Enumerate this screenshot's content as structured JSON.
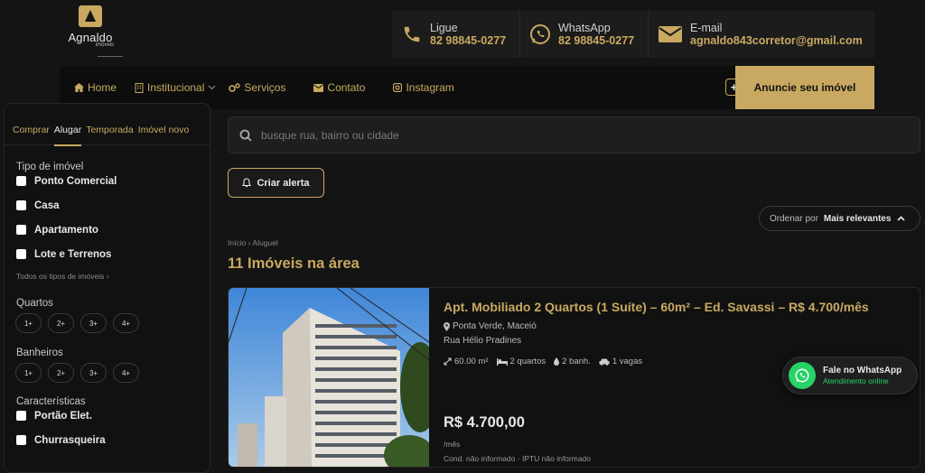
{
  "brand": {
    "name": "Agnaldo",
    "sub": "imóveis"
  },
  "contacts": [
    {
      "label": "Ligue",
      "value": "82 98845-0277",
      "icon": "phone-icon"
    },
    {
      "label": "WhatsApp",
      "value": "82 98845-0277",
      "icon": "whatsapp-icon"
    },
    {
      "label": "E-mail",
      "value": "agnaldo843corretor@gmail.com",
      "icon": "envelope-icon"
    }
  ],
  "nav": {
    "items": [
      "Home",
      "Institucional",
      "Serviços",
      "Contato",
      "Instagram"
    ],
    "plus": "+",
    "cta": "Anuncie seu imóvel"
  },
  "sidebar": {
    "tabs": [
      "Comprar",
      "Alugar",
      "Temporada",
      "Imóvel novo"
    ],
    "active_tab": "Alugar",
    "property_type": {
      "title": "Tipo de imóvel",
      "options": [
        "Ponto Comercial",
        "Casa",
        "Apartamento",
        "Lote e Terrenos"
      ],
      "all_link": "Todos os tipos de imóveis ›"
    },
    "rooms": {
      "title": "Quartos",
      "options": [
        "1+",
        "2+",
        "3+",
        "4+"
      ]
    },
    "baths": {
      "title": "Banheiros",
      "options": [
        "1+",
        "2+",
        "3+",
        "4+"
      ]
    },
    "features": {
      "title": "Características",
      "options": [
        "Portão Elet.",
        "Churrasqueira"
      ]
    }
  },
  "search": {
    "placeholder": "busque rua, bairro ou cidade",
    "value": ""
  },
  "alert_button": "Criar alerta",
  "sort": {
    "label": "Ordenar por",
    "value": "Mais relevantes"
  },
  "breadcrumb": "Início › Aluguel",
  "results_title": "11 Imóveis na área",
  "listing": {
    "title": "Apt. Mobiliado 2 Quartos (1 Suíte) – 60m² – Ed. Savassi – R$ 4.700/mês",
    "location": "Ponta Verde, Maceió",
    "street": "Rua Hélio Pradines",
    "features": {
      "area": "60.00 m²",
      "rooms": "2 quartos",
      "baths": "2 banh.",
      "parking": "1 vagas"
    },
    "price": "R$ 4.700,00",
    "price_unit": "/mês",
    "extra": "Cond. não informado · IPTU não informado"
  },
  "whatsapp_float": {
    "title": "Fale no WhatsApp",
    "subtitle": "Atendimento online"
  },
  "colors": {
    "accent": "#c9a961",
    "background": "#141414",
    "whatsapp": "#25d366"
  }
}
